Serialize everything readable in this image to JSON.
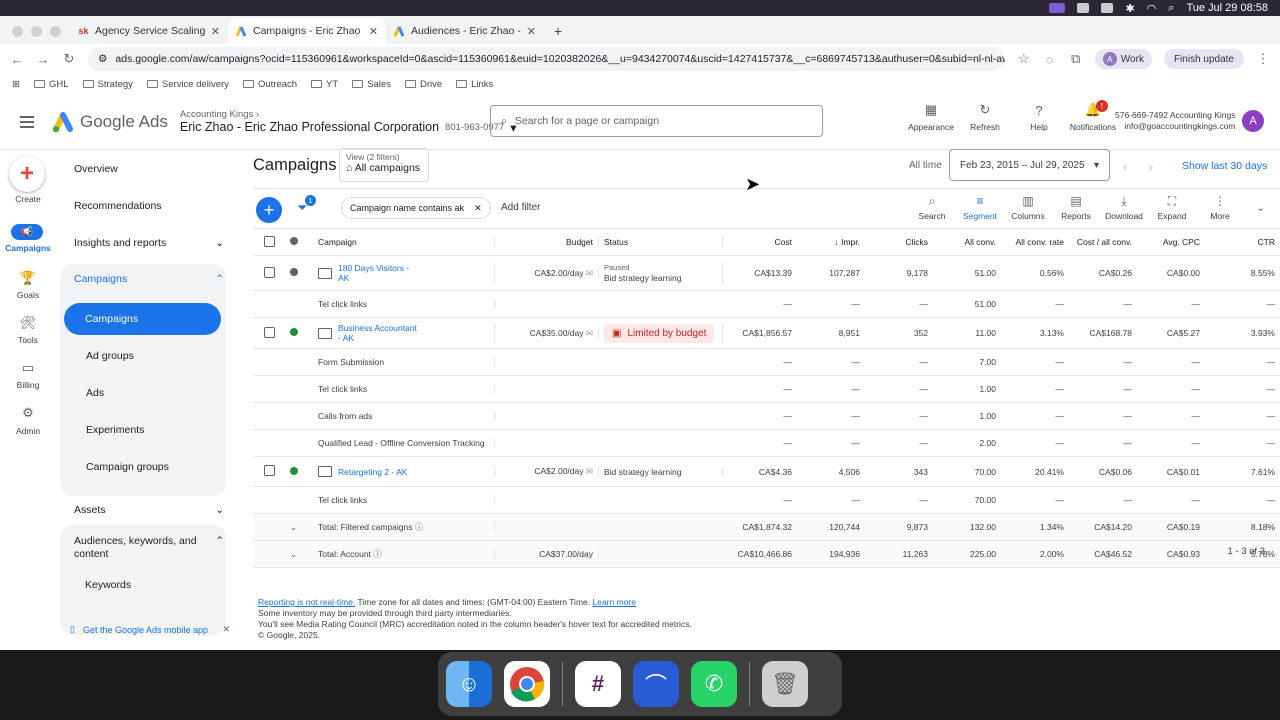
{
  "menubar": {
    "time": "Tue Jul 29  08:58"
  },
  "browser": {
    "tabs": [
      {
        "label": "Agency Service Scaling Kingp",
        "fav": "sk"
      },
      {
        "label": "Campaigns - Eric Zhao - Eric",
        "fav": "ads"
      },
      {
        "label": "Audiences - Eric Zhao - Eric",
        "fav": "ads"
      }
    ],
    "url": "ads.google.com/aw/campaigns?ocid=115360961&workspaceId=0&ascid=115360961&euid=1020382026&__u=9434270074&uscid=1427415737&__c=6869745713&authuser=0&subid=nl-nl-awhp-g-aw-c-home...",
    "profile": "Work",
    "finish": "Finish update",
    "bookmarks": [
      "GHL",
      "Strategy",
      "Service delivery",
      "Outreach",
      "YT",
      "Sales",
      "Drive",
      "Links"
    ]
  },
  "header": {
    "logo_text": "Google Ads",
    "breadcrumb": "Accounting Kings",
    "account_name": "Eric Zhao - Eric Zhao Professional Corporation",
    "account_id": "801-963-0977",
    "search_placeholder": "Search for a page or campaign",
    "icons": [
      {
        "label": "Appearance",
        "glyph": "▦"
      },
      {
        "label": "Refresh",
        "glyph": "↻"
      },
      {
        "label": "Help",
        "glyph": "?"
      },
      {
        "label": "Notifications",
        "glyph": "🔔"
      }
    ],
    "notif_count": "!",
    "user_line1": "576-669-7492 Accounting Kings",
    "user_line2": "info@goaccountingkings.com",
    "avatar": "A"
  },
  "rail": [
    {
      "label": "Create"
    },
    {
      "label": "Campaigns"
    },
    {
      "label": "Goals"
    },
    {
      "label": "Tools"
    },
    {
      "label": "Billing"
    },
    {
      "label": "Admin"
    }
  ],
  "sidebar": {
    "overview": "Overview",
    "recommendations": "Recommendations",
    "insights": "Insights and reports",
    "campaigns_head": "Campaigns",
    "active": "Campaigns",
    "sub": [
      "Ad groups",
      "Ads",
      "Experiments",
      "Campaign groups"
    ],
    "assets": "Assets",
    "audiences": "Audiences, keywords, and content",
    "keywords": "Keywords",
    "mobile": "Get the Google Ads mobile app"
  },
  "main": {
    "title": "Campaigns",
    "view_label": "View (2 filters)",
    "view_value": "All campaigns",
    "all_time": "All time",
    "date_range": "Feb 23, 2015 – Jul 29, 2025",
    "show_last": "Show last 30 days",
    "filter_count": "1",
    "chip": "Campaign name contains ak",
    "add_filter": "Add filter",
    "tools": [
      {
        "label": "Search",
        "glyph": "⌕"
      },
      {
        "label": "Segment",
        "glyph": "≡"
      },
      {
        "label": "Columns",
        "glyph": "▥"
      },
      {
        "label": "Reports",
        "glyph": "▤"
      },
      {
        "label": "Download",
        "glyph": "⤓"
      },
      {
        "label": "Expand",
        "glyph": "⛶"
      },
      {
        "label": "More",
        "glyph": "⋮"
      }
    ]
  },
  "table": {
    "headers": [
      "Campaign",
      "Budget",
      "Status",
      "Cost",
      "Impr.",
      "Clicks",
      "All conv.",
      "All conv. rate",
      "Cost / all conv.",
      "Avg. CPC",
      "CTR"
    ],
    "rows": [
      {
        "kind": "camp",
        "name": "180 Days Visitors - AK",
        "dot": "#5f6368",
        "budget": "CA$2.00/day",
        "status": "Bid strategy learning",
        "status_top": "Paused",
        "cost": "CA$13.39",
        "impr": "107,287",
        "clicks": "9,178",
        "allconv": "51.00",
        "rate": "0.56%",
        "cpa": "CA$0.26",
        "cpc": "CA$0.00",
        "ctr": "8.55%"
      },
      {
        "kind": "conv",
        "name": "Tel click links",
        "cost": "—",
        "impr": "—",
        "clicks": "—",
        "allconv": "51.00",
        "rate": "—",
        "cpa": "—",
        "cpc": "—",
        "ctr": "—"
      },
      {
        "kind": "camp",
        "name": "Business Accountant - AK",
        "dot": "#1e8e3e",
        "budget": "CA$35.00/day",
        "status": "Limited by budget",
        "cost": "CA$1,856.57",
        "impr": "8,951",
        "clicks": "352",
        "allconv": "11.00",
        "rate": "3.13%",
        "cpa": "CA$168.78",
        "cpc": "CA$5.27",
        "ctr": "3.93%"
      },
      {
        "kind": "conv",
        "name": "Form Submission",
        "cost": "—",
        "impr": "—",
        "clicks": "—",
        "allconv": "7.00",
        "rate": "—",
        "cpa": "—",
        "cpc": "—",
        "ctr": "—"
      },
      {
        "kind": "conv",
        "name": "Tel click links",
        "cost": "—",
        "impr": "—",
        "clicks": "—",
        "allconv": "1.00",
        "rate": "—",
        "cpa": "—",
        "cpc": "—",
        "ctr": "—"
      },
      {
        "kind": "conv",
        "name": "Calls from ads",
        "cost": "—",
        "impr": "—",
        "clicks": "—",
        "allconv": "1.00",
        "rate": "—",
        "cpa": "—",
        "cpc": "—",
        "ctr": "—"
      },
      {
        "kind": "conv",
        "name": "Qualified Lead - Offline Conversion Tracking",
        "cost": "—",
        "impr": "—",
        "clicks": "—",
        "allconv": "2.00",
        "rate": "—",
        "cpa": "—",
        "cpc": "—",
        "ctr": "—"
      },
      {
        "kind": "camp",
        "name": "Retargeting 2 - AK",
        "dot": "#1e8e3e",
        "budget": "CA$2.00/day",
        "status": "Bid strategy learning",
        "cost": "CA$4.36",
        "impr": "4,506",
        "clicks": "343",
        "allconv": "70.00",
        "rate": "20.41%",
        "cpa": "CA$0.06",
        "cpc": "CA$0.01",
        "ctr": "7.61%"
      },
      {
        "kind": "conv",
        "name": "Tel click links",
        "cost": "—",
        "impr": "—",
        "clicks": "—",
        "allconv": "70.00",
        "rate": "—",
        "cpa": "—",
        "cpc": "—",
        "ctr": "—"
      }
    ],
    "totals": [
      {
        "label": "Total: Filtered campaigns",
        "budget": "",
        "cost": "CA$1,874.32",
        "impr": "120,744",
        "clicks": "9,873",
        "allconv": "132.00",
        "rate": "1.34%",
        "cpa": "CA$14.20",
        "cpc": "CA$0.19",
        "ctr": "8.18%"
      },
      {
        "label": "Total: Account",
        "budget": "CA$37.00/day",
        "cost": "CA$10,466.86",
        "impr": "194,936",
        "clicks": "11,263",
        "allconv": "225.00",
        "rate": "2.00%",
        "cpa": "CA$46.52",
        "cpc": "CA$0.93",
        "ctr": "5.78%"
      }
    ],
    "pager": "1 - 3 of 3"
  },
  "footer": {
    "realtime": "Reporting is not real-time.",
    "tz": " Time zone for all dates and times: (GMT-04:00) Eastern Time. ",
    "learn": "Learn more",
    "line2": "Some inventory may be provided through third party intermediaries.",
    "line3": "You'll see Media Rating Council (MRC) accreditation noted in the column header's hover text for accredited metrics.",
    "line4": "© Google, 2025."
  },
  "dock": [
    "Finder",
    "Chrome",
    "Slack",
    "Arc",
    "WhatsApp",
    "Trash"
  ]
}
